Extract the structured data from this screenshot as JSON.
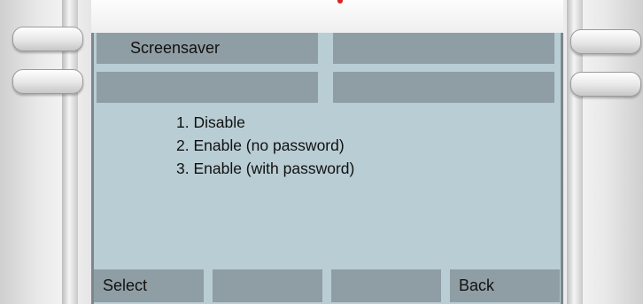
{
  "line_keys": [
    {
      "label": "Screensaver"
    },
    {
      "label": ""
    },
    {
      "label": ""
    },
    {
      "label": ""
    }
  ],
  "menu": {
    "items": [
      {
        "label": "1. Disable"
      },
      {
        "label": "2. Enable (no password)"
      },
      {
        "label": "3. Enable (with password)"
      }
    ]
  },
  "softkeys": [
    {
      "label": "Select"
    },
    {
      "label": ""
    },
    {
      "label": ""
    },
    {
      "label": "Back"
    }
  ],
  "colors": {
    "screen_background": "#b9cdd4",
    "key_background": "#8f9ea4",
    "housing": "#f1f1f1"
  }
}
